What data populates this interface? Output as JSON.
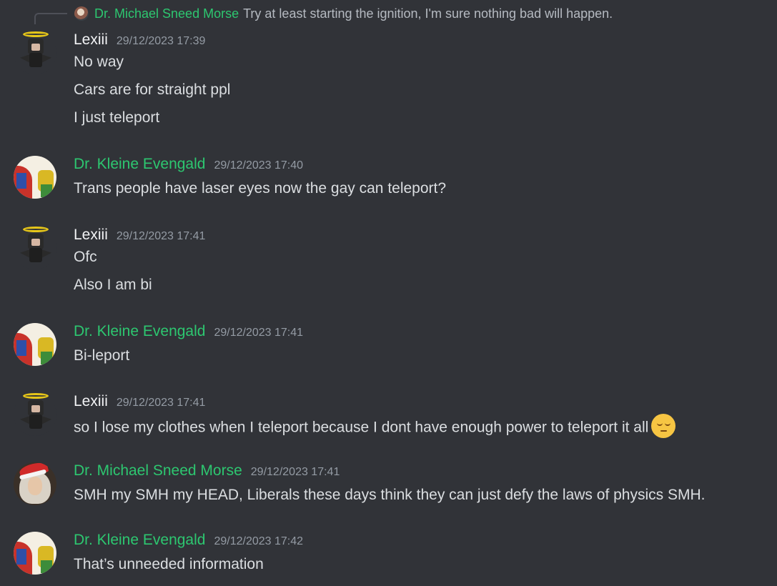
{
  "reply": {
    "author": "Dr. Michael Sneed Morse",
    "text": "Try at least starting the ignition, I'm sure nothing bad will happen."
  },
  "messages": [
    {
      "author": "Lexiii",
      "timestamp": "29/12/2023 17:39",
      "lines": [
        "No way",
        "Cars are for straight ppl",
        "I just teleport"
      ]
    },
    {
      "author": "Dr. Kleine Evengald",
      "timestamp": "29/12/2023 17:40",
      "lines": [
        "Trans people have laser eyes now the gay can teleport?"
      ]
    },
    {
      "author": "Lexiii",
      "timestamp": "29/12/2023 17:41",
      "lines": [
        "Ofc",
        "Also I am bi"
      ]
    },
    {
      "author": "Dr. Kleine Evengald",
      "timestamp": "29/12/2023 17:41",
      "lines": [
        "Bi-leport"
      ]
    },
    {
      "author": "Lexiii",
      "timestamp": "29/12/2023 17:41",
      "lines": [
        "so I lose my clothes when I teleport because I dont have enough power to teleport it all"
      ],
      "emoji": "pensive-face-emoji"
    },
    {
      "author": "Dr. Michael Sneed Morse",
      "timestamp": "29/12/2023 17:41",
      "lines": [
        "SMH my SMH my HEAD, Liberals these days think they can just defy the laws of physics SMH."
      ]
    },
    {
      "author": "Dr. Kleine Evengald",
      "timestamp": "29/12/2023 17:42",
      "lines": [
        "That’s unneeded information"
      ]
    }
  ],
  "colors": {
    "background": "#313338",
    "role_green": "#2dc770",
    "text": "#dbdee1",
    "timestamp": "#949ba4"
  }
}
